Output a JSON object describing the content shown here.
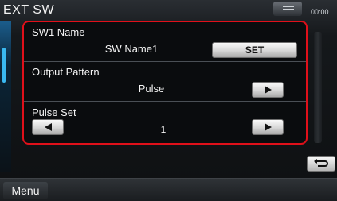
{
  "header": {
    "title": "EXT SW",
    "clock": "00:00"
  },
  "settings": {
    "sw1_name": {
      "label": "SW1 Name",
      "value": "SW Name1",
      "set_label": "SET"
    },
    "output_pattern": {
      "label": "Output Pattern",
      "value": "Pulse"
    },
    "pulse_set": {
      "label": "Pulse Set",
      "value": "1"
    }
  },
  "footer": {
    "menu_label": "Menu"
  },
  "icons": {
    "top_tab": "list-icon",
    "next": "arrow-right-icon",
    "prev": "arrow-left-icon",
    "back": "return-icon"
  },
  "colors": {
    "highlight_border": "#e0101a",
    "accent": "#3ab8f0"
  }
}
